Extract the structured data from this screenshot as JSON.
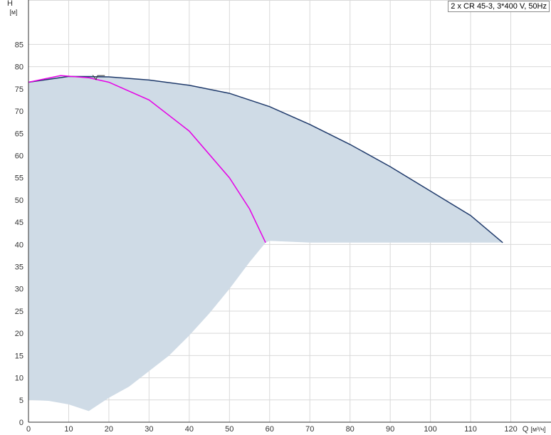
{
  "chart_data": {
    "type": "line",
    "legend_text": "2 x CR 45-3, 3*400 V, 50Hz",
    "legend_position": "top-right",
    "xlabel": "Q",
    "xunit": "[м³/ч]",
    "ylabel": "H",
    "yunit": "[м]",
    "xlim": [
      0,
      130
    ],
    "ylim": [
      0,
      95
    ],
    "x_ticks": [
      0,
      10,
      20,
      30,
      40,
      50,
      60,
      70,
      80,
      90,
      100,
      110,
      120
    ],
    "y_ticks": [
      0,
      5,
      10,
      15,
      20,
      25,
      30,
      35,
      40,
      45,
      50,
      55,
      60,
      65,
      70,
      75,
      80,
      85
    ],
    "grid": true,
    "series": [
      {
        "key": "two_pumps",
        "color": "#1f3a6b",
        "points": [
          [
            0,
            76.5
          ],
          [
            10,
            77.8
          ],
          [
            20,
            77.7
          ],
          [
            30,
            77.0
          ],
          [
            40,
            75.8
          ],
          [
            50,
            74.0
          ],
          [
            60,
            71.0
          ],
          [
            70,
            67.0
          ],
          [
            80,
            62.5
          ],
          [
            90,
            57.5
          ],
          [
            100,
            52.0
          ],
          [
            110,
            46.5
          ],
          [
            118,
            40.4
          ]
        ]
      },
      {
        "key": "one_pump",
        "color": "#e600e6",
        "points": [
          [
            0,
            76.5
          ],
          [
            8,
            78.0
          ],
          [
            15,
            77.5
          ],
          [
            20,
            76.5
          ],
          [
            30,
            72.5
          ],
          [
            40,
            65.5
          ],
          [
            50,
            55.0
          ],
          [
            55,
            48.0
          ],
          [
            59,
            40.4
          ]
        ]
      }
    ],
    "region": {
      "color": "#cfdbe6",
      "upper": [
        [
          0,
          76.5
        ],
        [
          8,
          77.8
        ],
        [
          16,
          78.1
        ],
        [
          16.8,
          77.1
        ],
        [
          17.2,
          78.0
        ],
        [
          30,
          77.0
        ],
        [
          40,
          75.8
        ],
        [
          50,
          74.0
        ],
        [
          60,
          71.0
        ],
        [
          70,
          67.0
        ],
        [
          80,
          62.5
        ],
        [
          90,
          57.5
        ],
        [
          100,
          52.0
        ],
        [
          110,
          46.5
        ],
        [
          118,
          40.4
        ]
      ],
      "lower": [
        [
          118,
          40.4
        ],
        [
          70,
          40.4
        ],
        [
          60,
          40.8
        ],
        [
          59,
          40.4
        ],
        [
          55,
          36.0
        ],
        [
          50,
          30.0
        ],
        [
          45,
          24.5
        ],
        [
          40,
          19.5
        ],
        [
          35,
          15.0
        ],
        [
          30,
          11.5
        ],
        [
          25,
          8.0
        ],
        [
          20,
          5.5
        ],
        [
          15,
          2.5
        ],
        [
          10,
          4.0
        ],
        [
          5,
          4.8
        ],
        [
          0,
          5.0
        ]
      ]
    },
    "top_markers": {
      "color": "#333333",
      "points": [
        [
          16,
          78.1
        ],
        [
          16.8,
          77.1
        ],
        [
          17.2,
          78.0
        ],
        [
          19,
          78.0
        ]
      ]
    }
  }
}
